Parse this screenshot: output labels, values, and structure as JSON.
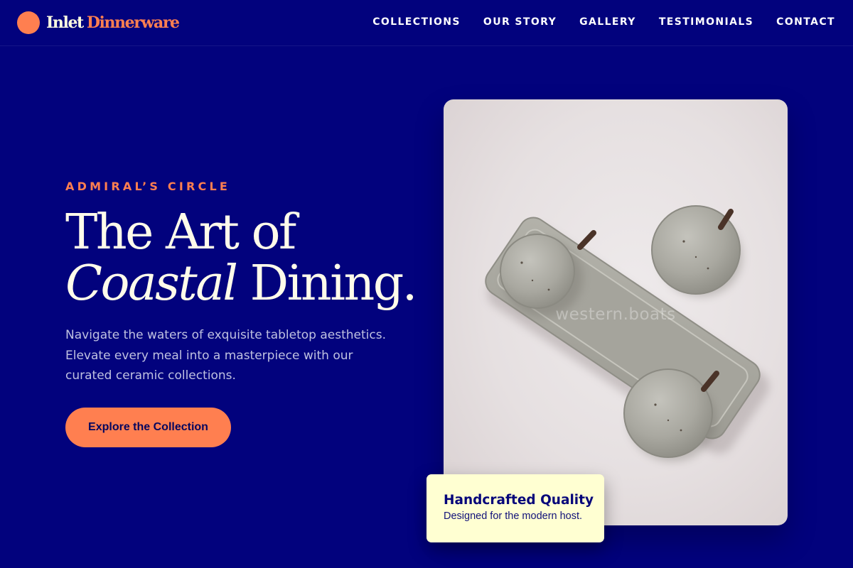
{
  "brand": {
    "name_first": "Inlet",
    "name_second": "Dinnerware",
    "accent_color": "#ff7f50",
    "background_color": "#02027d"
  },
  "nav": {
    "items": [
      {
        "label": "COLLECTIONS"
      },
      {
        "label": "OUR STORY"
      },
      {
        "label": "GALLERY"
      },
      {
        "label": "TESTIMONIALS"
      },
      {
        "label": "CONTACT"
      }
    ]
  },
  "hero": {
    "eyebrow": "ADMIRAL’S CIRCLE",
    "headline_line1": "The Art of",
    "headline_italic": "Coastal",
    "headline_rest": "Dining.",
    "description": "Navigate the waters of exquisite tabletop aesthetics. Elevate every meal into a masterpiece with our curated ceramic collections.",
    "cta_label": "Explore the Collection"
  },
  "image": {
    "watermark": "western.boats",
    "subject": "ceramic-lidded-jars-on-tray"
  },
  "badge": {
    "title": "Handcrafted Quality",
    "subtitle": "Designed for the modern host."
  }
}
